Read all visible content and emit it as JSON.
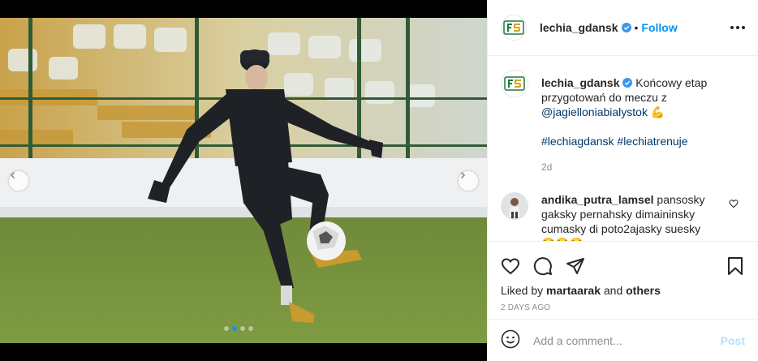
{
  "post": {
    "username": "lechia_gdansk",
    "separator": "•",
    "follow_label": "Follow",
    "caption": {
      "text_before": "Końcowy etap przygotowań do meczu z ",
      "mention": "@jagielloniabialystok",
      "emoji": "💪",
      "hashtag1": "#lechiagdansk",
      "hashtag2": "#lechiatrenuje",
      "time": "2d"
    },
    "comment": {
      "username": "andika_putra_lamsel",
      "text": "pansosky gaksky pernahsky dimaininsky cumasky di poto2ajasky suesky",
      "emoji": "😂😂😂"
    },
    "likes": {
      "prefix": "Liked by ",
      "user": "martaarak",
      "joiner": " and ",
      "others": "others"
    },
    "date": "2 days ago",
    "add_comment_placeholder": "Add a comment...",
    "post_label": "Post",
    "carousel": {
      "slides": 4,
      "active_index": 1
    }
  },
  "colors": {
    "link_blue": "#0095f6",
    "mention_blue": "#00376b",
    "post_disabled": "#b2dffc",
    "muted_gray": "#8e8e8e",
    "logo_green": "#1e7a3c",
    "logo_gold": "#d6a126"
  },
  "icons": {
    "prev": "chevron-left-icon",
    "next": "chevron-right-icon",
    "verified": "verified-badge-icon",
    "more": "more-options-icon",
    "like": "heart-icon",
    "comment": "comment-bubble-icon",
    "share": "paper-plane-icon",
    "save": "bookmark-icon",
    "emoji": "smiley-icon"
  }
}
